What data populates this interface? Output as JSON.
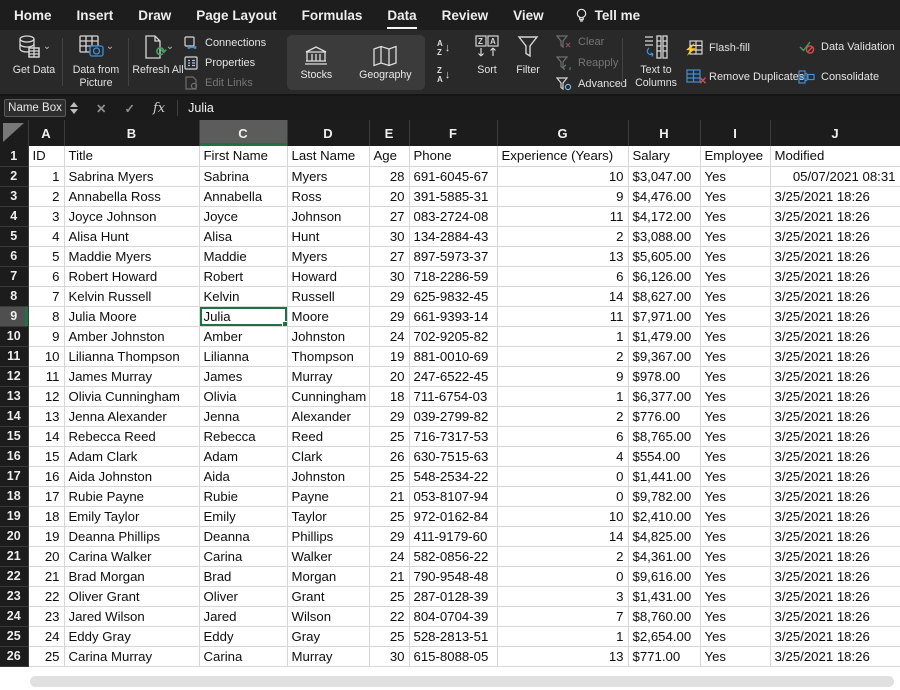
{
  "menu": {
    "tabs": [
      "Home",
      "Insert",
      "Draw",
      "Page Layout",
      "Formulas",
      "Data",
      "Review",
      "View"
    ],
    "active_tab": "Data",
    "tell_me": "Tell me"
  },
  "ribbon": {
    "get_data": "Get Data",
    "data_from_picture": "Data from Picture",
    "refresh_all": "Refresh All",
    "connections": "Connections",
    "properties": "Properties",
    "edit_links": "Edit Links",
    "stocks": "Stocks",
    "geography": "Geography",
    "sort": "Sort",
    "filter": "Filter",
    "clear": "Clear",
    "reapply": "Reapply",
    "advanced": "Advanced",
    "text_to_columns": "Text to Columns",
    "flash_fill": "Flash-fill",
    "remove_duplicates": "Remove Duplicates",
    "data_validation": "Data Validation",
    "consolidate": "Consolidate"
  },
  "formula_bar": {
    "name_box": "Name Box",
    "cancel_glyph": "✕",
    "confirm_glyph": "✓",
    "fx_glyph": "fx",
    "value": "Julia"
  },
  "grid": {
    "columns": [
      "A",
      "B",
      "C",
      "D",
      "E",
      "F",
      "G",
      "H",
      "I",
      "J"
    ],
    "selected_column": "C",
    "selected_row": 9,
    "selected_cell_column": "C",
    "selected_cell_ref": "C9",
    "align": [
      "right",
      "left",
      "left",
      "left",
      "right",
      "left",
      "right",
      "left",
      "left",
      "left"
    ],
    "align_overrides": [
      {
        "row": 2,
        "col": "J",
        "align": "right"
      }
    ],
    "header_row": [
      "ID",
      "Title",
      "First Name",
      "Last Name",
      "Age",
      "Phone",
      "Experience (Years)",
      "Salary",
      "Employee",
      "Modified"
    ],
    "rows": [
      [
        1,
        "Sabrina Myers",
        "Sabrina",
        "Myers",
        28,
        "691-6045-67",
        10,
        "$3,047.00",
        "Yes",
        "05/07/2021 08:31"
      ],
      [
        2,
        "Annabella Ross",
        "Annabella",
        "Ross",
        20,
        "391-5885-31",
        9,
        "$4,476.00",
        "Yes",
        "3/25/2021 18:26"
      ],
      [
        3,
        "Joyce Johnson",
        "Joyce",
        "Johnson",
        27,
        "083-2724-08",
        11,
        "$4,172.00",
        "Yes",
        "3/25/2021 18:26"
      ],
      [
        4,
        "Alisa Hunt",
        "Alisa",
        "Hunt",
        30,
        "134-2884-43",
        2,
        "$3,088.00",
        "Yes",
        "3/25/2021 18:26"
      ],
      [
        5,
        "Maddie Myers",
        "Maddie",
        "Myers",
        27,
        "897-5973-37",
        13,
        "$5,605.00",
        "Yes",
        "3/25/2021 18:26"
      ],
      [
        6,
        "Robert Howard",
        "Robert",
        "Howard",
        30,
        "718-2286-59",
        6,
        "$6,126.00",
        "Yes",
        "3/25/2021 18:26"
      ],
      [
        7,
        "Kelvin Russell",
        "Kelvin",
        "Russell",
        29,
        "625-9832-45",
        14,
        "$8,627.00",
        "Yes",
        "3/25/2021 18:26"
      ],
      [
        8,
        "Julia Moore",
        "Julia",
        "Moore",
        29,
        "661-9393-14",
        11,
        "$7,971.00",
        "Yes",
        "3/25/2021 18:26"
      ],
      [
        9,
        "Amber Johnston",
        "Amber",
        "Johnston",
        24,
        "702-9205-82",
        1,
        "$1,479.00",
        "Yes",
        "3/25/2021 18:26"
      ],
      [
        10,
        "Lilianna Thompson",
        "Lilianna",
        "Thompson",
        19,
        "881-0010-69",
        2,
        "$9,367.00",
        "Yes",
        "3/25/2021 18:26"
      ],
      [
        11,
        "James Murray",
        "James",
        "Murray",
        20,
        "247-6522-45",
        9,
        "$978.00",
        "Yes",
        "3/25/2021 18:26"
      ],
      [
        12,
        "Olivia Cunningham",
        "Olivia",
        "Cunningham",
        18,
        "711-6754-03",
        1,
        "$6,377.00",
        "Yes",
        "3/25/2021 18:26"
      ],
      [
        13,
        "Jenna Alexander",
        "Jenna",
        "Alexander",
        29,
        "039-2799-82",
        2,
        "$776.00",
        "Yes",
        "3/25/2021 18:26"
      ],
      [
        14,
        "Rebecca Reed",
        "Rebecca",
        "Reed",
        25,
        "716-7317-53",
        6,
        "$8,765.00",
        "Yes",
        "3/25/2021 18:26"
      ],
      [
        15,
        "Adam Clark",
        "Adam",
        "Clark",
        26,
        "630-7515-63",
        4,
        "$554.00",
        "Yes",
        "3/25/2021 18:26"
      ],
      [
        16,
        "Aida Johnston",
        "Aida",
        "Johnston",
        25,
        "548-2534-22",
        0,
        "$1,441.00",
        "Yes",
        "3/25/2021 18:26"
      ],
      [
        17,
        "Rubie Payne",
        "Rubie",
        "Payne",
        21,
        "053-8107-94",
        0,
        "$9,782.00",
        "Yes",
        "3/25/2021 18:26"
      ],
      [
        18,
        "Emily Taylor",
        "Emily",
        "Taylor",
        25,
        "972-0162-84",
        10,
        "$2,410.00",
        "Yes",
        "3/25/2021 18:26"
      ],
      [
        19,
        "Deanna Phillips",
        "Deanna",
        "Phillips",
        29,
        "411-9179-60",
        14,
        "$4,825.00",
        "Yes",
        "3/25/2021 18:26"
      ],
      [
        20,
        "Carina Walker",
        "Carina",
        "Walker",
        24,
        "582-0856-22",
        2,
        "$4,361.00",
        "Yes",
        "3/25/2021 18:26"
      ],
      [
        21,
        "Brad Morgan",
        "Brad",
        "Morgan",
        21,
        "790-9548-48",
        0,
        "$9,616.00",
        "Yes",
        "3/25/2021 18:26"
      ],
      [
        22,
        "Oliver Grant",
        "Oliver",
        "Grant",
        25,
        "287-0128-39",
        3,
        "$1,431.00",
        "Yes",
        "3/25/2021 18:26"
      ],
      [
        23,
        "Jared Wilson",
        "Jared",
        "Wilson",
        22,
        "804-0704-39",
        7,
        "$8,760.00",
        "Yes",
        "3/25/2021 18:26"
      ],
      [
        24,
        "Eddy Gray",
        "Eddy",
        "Gray",
        25,
        "528-2813-51",
        1,
        "$2,654.00",
        "Yes",
        "3/25/2021 18:26"
      ],
      [
        25,
        "Carina Murray",
        "Carina",
        "Murray",
        30,
        "615-8088-05",
        13,
        "$771.00",
        "Yes",
        "3/25/2021 18:26"
      ]
    ]
  },
  "colors": {
    "selection_green": "#1e7145",
    "menubar_bg": "#1d1d1d",
    "ribbon_bg": "#292929",
    "header_bg": "#1c1c1c",
    "selected_header_bg": "#5c5c5c",
    "gridline": "#d7d7d7",
    "flash_fill_accent": "#f0b400",
    "blue_accent": "#3f8fd6",
    "green_accent": "#44a25e",
    "red_accent": "#d84b4b"
  }
}
